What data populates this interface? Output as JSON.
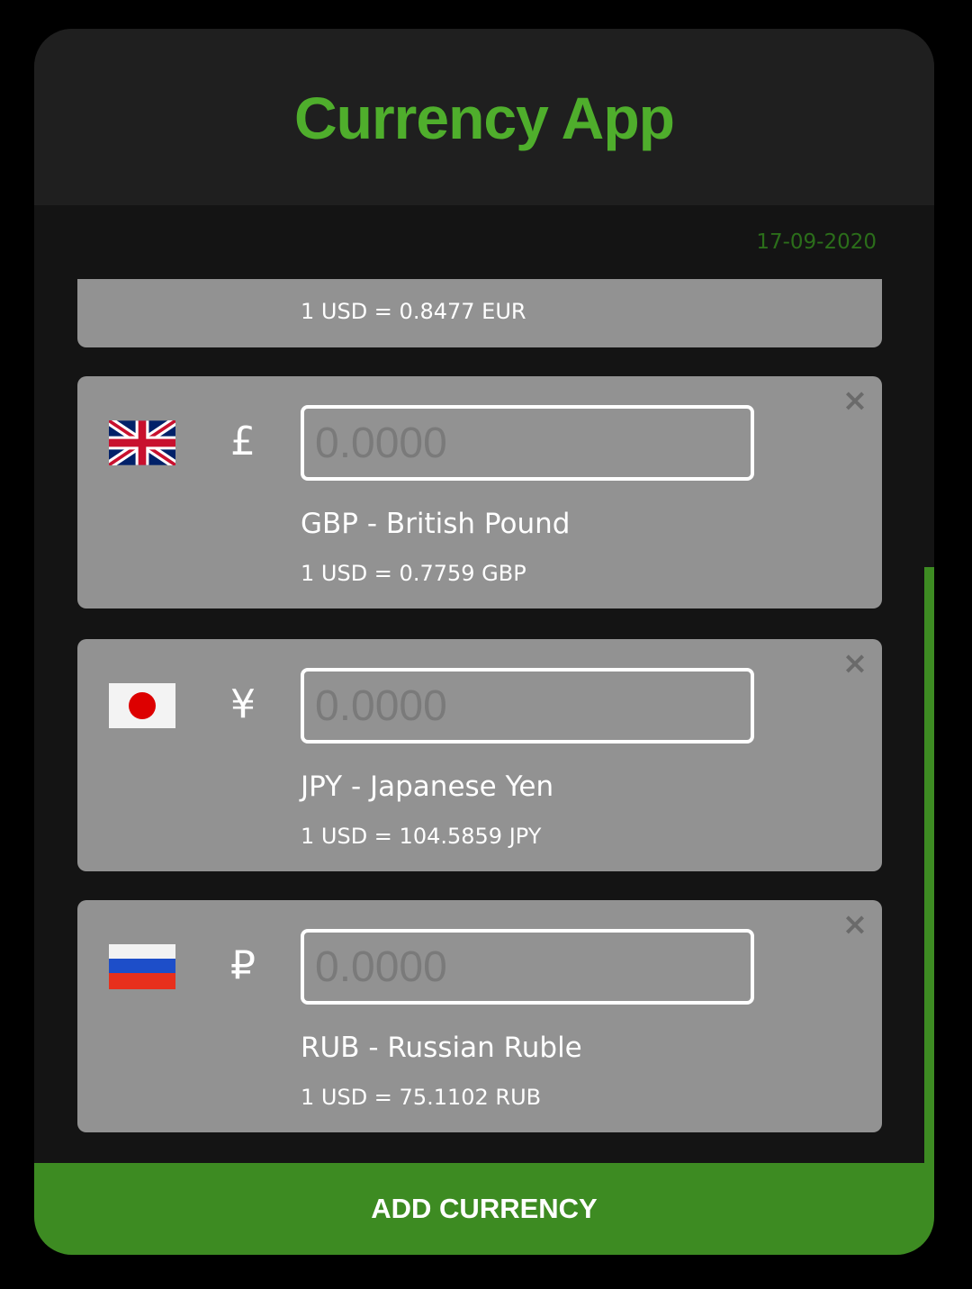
{
  "app": {
    "title": "Currency App",
    "date": "17-09-2020"
  },
  "currencies": [
    {
      "rate_text": "1 USD = 0.8477 EUR"
    },
    {
      "code_name": "GBP - British Pound",
      "symbol": "£",
      "placeholder": "0.0000",
      "rate_text": "1 USD = 0.7759 GBP",
      "close_label": "×",
      "flag": "uk-flag-icon"
    },
    {
      "code_name": "JPY - Japanese Yen",
      "symbol": "¥",
      "placeholder": "0.0000",
      "rate_text": "1 USD = 104.5859 JPY",
      "close_label": "×",
      "flag": "japan-flag-icon"
    },
    {
      "code_name": "RUB - Russian Ruble",
      "symbol": "₽",
      "placeholder": "0.0000",
      "rate_text": "1 USD = 75.1102 RUB",
      "close_label": "×",
      "flag": "russia-flag-icon"
    }
  ],
  "footer": {
    "add_label": "ADD CURRENCY"
  },
  "colors": {
    "accent": "#4fae2c",
    "button": "#3d8b22",
    "card": "#929292",
    "background": "#141414",
    "header": "#1f1f1f"
  }
}
